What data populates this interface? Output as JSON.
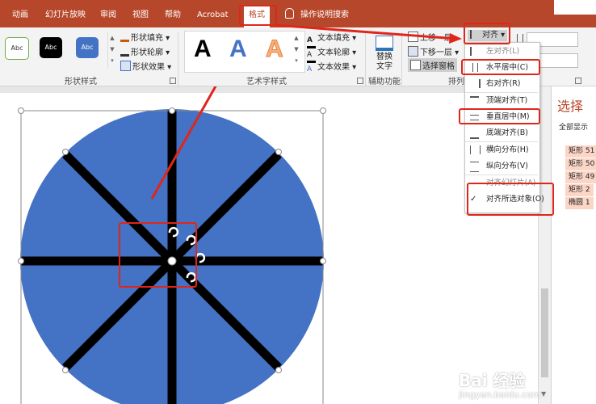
{
  "tabs": [
    {
      "label": "动画"
    },
    {
      "label": "幻灯片放映"
    },
    {
      "label": "审阅"
    },
    {
      "label": "视图"
    },
    {
      "label": "帮助"
    },
    {
      "label": "Acrobat"
    },
    {
      "label": "格式"
    },
    {
      "label": "操作说明搜索"
    }
  ],
  "shape_styles": {
    "samples": [
      "Abc",
      "Abc",
      "Abc"
    ],
    "fill": "形状填充",
    "outline": "形状轮廓",
    "effects": "形状效果",
    "group_label": "形状样式"
  },
  "wordart": {
    "glyph": "A",
    "text_fill": "文本填充",
    "text_outline": "文本轮廓",
    "text_effects": "文本效果",
    "group_label": "艺术字样式"
  },
  "accessibility": {
    "alt_text_line1": "替换",
    "alt_text_line2": "文字",
    "group_label": "辅助功能"
  },
  "arrange": {
    "bring_forward": "上移一层",
    "send_backward": "下移一层",
    "selection_pane": "选择窗格",
    "align": "对齐",
    "group_label": "排列"
  },
  "align_menu": {
    "items": [
      {
        "label": "左对齐(L)",
        "checked": false
      },
      {
        "label": "水平居中(C)",
        "checked": false
      },
      {
        "label": "右对齐(R)",
        "checked": false
      },
      {
        "label": "顶端对齐(T)",
        "checked": false
      },
      {
        "label": "垂直居中(M)",
        "checked": false
      },
      {
        "label": "底端对齐(B)",
        "checked": false
      },
      {
        "label": "横向分布(H)",
        "checked": false
      },
      {
        "label": "纵向分布(V)",
        "checked": false
      },
      {
        "label": "对齐幻灯片(A)",
        "checked": false
      },
      {
        "label": "对齐所选对象(O)",
        "checked": true
      }
    ]
  },
  "selection_pane": {
    "title": "选择",
    "show_all": "全部显示",
    "items": [
      "矩形 51",
      "矩形 50",
      "矩形 49",
      "矩形 2",
      "椭圆 1"
    ]
  },
  "watermark": {
    "brand": "Bai  经验",
    "url": "jingyan.baidu.com"
  },
  "colors": {
    "accent": "#b7472a",
    "circle": "#4472c4",
    "annotation": "#e0261b"
  }
}
